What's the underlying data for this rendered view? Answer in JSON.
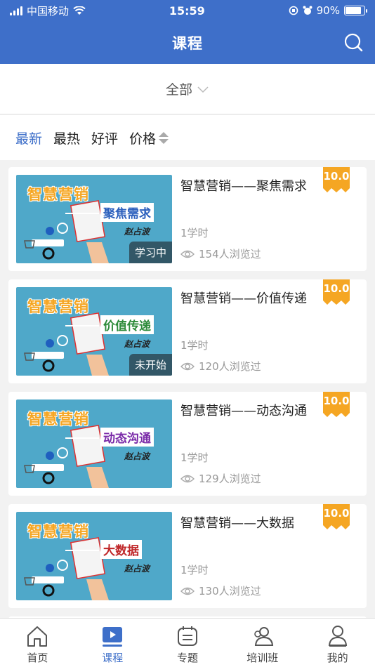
{
  "status_bar": {
    "carrier": "中国移动",
    "time": "15:59",
    "battery": "90%",
    "battery_level": 0.9
  },
  "navbar": {
    "title": "课程",
    "search_icon": "search-icon"
  },
  "filter": {
    "label": "全部",
    "icon": "chevron-down-icon"
  },
  "sort_tabs": [
    {
      "label": "最新",
      "active": true
    },
    {
      "label": "最热",
      "active": false
    },
    {
      "label": "好评",
      "active": false
    },
    {
      "label": "价格",
      "active": false
    }
  ],
  "courses": [
    {
      "title": "智慧营销——聚焦需求",
      "thumb_title": "智慧营销",
      "thumb_sub": "聚焦需求",
      "thumb_sub_color": "#2b5fbd",
      "thumb_author": "赵占波",
      "status": "学习中",
      "hours": "1学时",
      "views": "154人浏览过",
      "score": "10.0"
    },
    {
      "title": "智慧营销——价值传递",
      "thumb_title": "智慧营销",
      "thumb_sub": "价值传递",
      "thumb_sub_color": "#2e8b3a",
      "thumb_author": "赵占波",
      "status": "未开始",
      "hours": "1学时",
      "views": "120人浏览过",
      "score": "10.0"
    },
    {
      "title": "智慧营销——动态沟通",
      "thumb_title": "智慧营销",
      "thumb_sub": "动态沟通",
      "thumb_sub_color": "#7a2aa8",
      "thumb_author": "赵占波",
      "status": "",
      "hours": "1学时",
      "views": "129人浏览过",
      "score": "10.0"
    },
    {
      "title": "智慧营销——大数据",
      "thumb_title": "智慧营销",
      "thumb_sub": "大数据",
      "thumb_sub_color": "#c0282a",
      "thumb_author": "赵占波",
      "status": "",
      "hours": "1学时",
      "views": "130人浏览过",
      "score": "10.0"
    }
  ],
  "tabbar": [
    {
      "label": "首页",
      "icon": "home-icon",
      "active": false
    },
    {
      "label": "课程",
      "icon": "course-play-icon",
      "active": true
    },
    {
      "label": "专题",
      "icon": "topic-icon",
      "active": false
    },
    {
      "label": "培训班",
      "icon": "class-icon",
      "active": false
    },
    {
      "label": "我的",
      "icon": "profile-icon",
      "active": false
    }
  ],
  "colors": {
    "primary": "#3e6fc9",
    "score_badge": "#f5a623",
    "thumb_bg": "#4fa8c9"
  }
}
